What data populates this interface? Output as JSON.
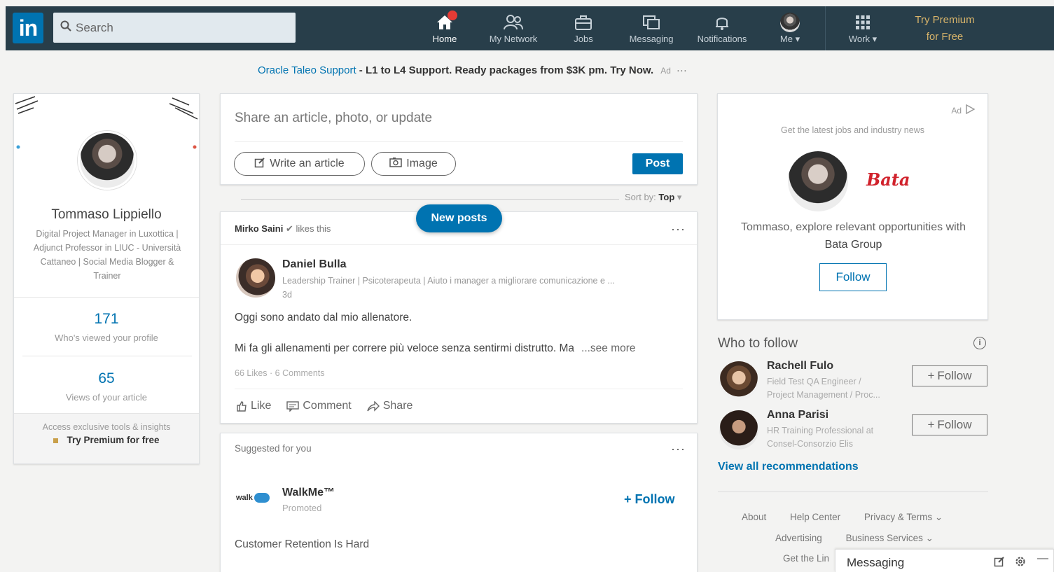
{
  "nav": {
    "logo": "in",
    "search_placeholder": "Search",
    "items": [
      {
        "label": "Home"
      },
      {
        "label": "My Network"
      },
      {
        "label": "Jobs"
      },
      {
        "label": "Messaging"
      },
      {
        "label": "Notifications"
      },
      {
        "label": "Me"
      },
      {
        "label": "Work"
      }
    ],
    "premium": [
      "Try Premium",
      "for Free"
    ]
  },
  "ad_banner": {
    "link": "Oracle Taleo Support",
    "text": " - L1 to L4 Support. Ready packages from $3K pm. Try Now.",
    "tag": "Ad",
    "more": "···"
  },
  "profile": {
    "name": "Tommaso Lippiello",
    "headline": "Digital Project Manager in Luxottica | Adjunct Professor in LIUC - Università Cattaneo | Social Media Blogger & Trainer",
    "views_profile": "171",
    "views_profile_label": "Who's viewed your profile",
    "views_article": "65",
    "views_article_label": "Views of your article",
    "footer_line1": "Access exclusive tools & insights",
    "footer_line2": "Try Premium for free"
  },
  "share": {
    "placeholder": "Share an article, photo, or update",
    "write_article": "Write an article",
    "image": "Image",
    "post": "Post"
  },
  "sort": {
    "label": "Sort by:",
    "value": "Top"
  },
  "new_posts": "New posts",
  "post": {
    "liker": "Mirko Saini",
    "liker_suffix": " likes this",
    "author": "Daniel Bulla",
    "author_headline": "Leadership Trainer | Psicoterapeuta | Aiuto i manager a migliorare comunicazione e ...",
    "time": "3d",
    "line1": "Oggi sono andato dal mio allenatore.",
    "line2": "Mi fa gli allenamenti per correre più veloce senza sentirmi distrutto. Ma",
    "see_more": "...see more",
    "meta": "66 Likes · 6 Comments",
    "like": "Like",
    "comment": "Comment",
    "share": "Share"
  },
  "suggested": {
    "label": "Suggested for you",
    "logo_text": "walk",
    "company": "WalkMe™",
    "promoted": "Promoted",
    "follow": "+ Follow",
    "body": "Customer Retention Is Hard"
  },
  "right_ad": {
    "tag": "Ad",
    "subtitle": "Get the latest jobs and industry news",
    "brand": "Bata",
    "message_prefix": "Tommaso, explore relevant opportunities with ",
    "message_company": "Bata Group",
    "follow": "Follow"
  },
  "who_to_follow": {
    "title": "Who to follow",
    "people": [
      {
        "name": "Rachell Fulo",
        "line1": "Field Test QA Engineer /",
        "line2": "Project Management / Proc...",
        "follow": "Follow"
      },
      {
        "name": "Anna Parisi",
        "line1": "HR Training Professional at",
        "line2": "Consel-Consorzio Elis",
        "follow": "Follow"
      }
    ],
    "view_all": "View all recommendations"
  },
  "footer": {
    "about": "About",
    "help": "Help Center",
    "privacy": "Privacy & Terms",
    "advertising": "Advertising",
    "business": "Business Services",
    "get_app": "Get the Lin"
  },
  "messaging": {
    "label": "Messaging"
  },
  "colors": {
    "nav_bg": "#283e4a",
    "accent": "#0073b1",
    "premium_gold": "#d8b46a",
    "brand_red": "#d1222c"
  }
}
